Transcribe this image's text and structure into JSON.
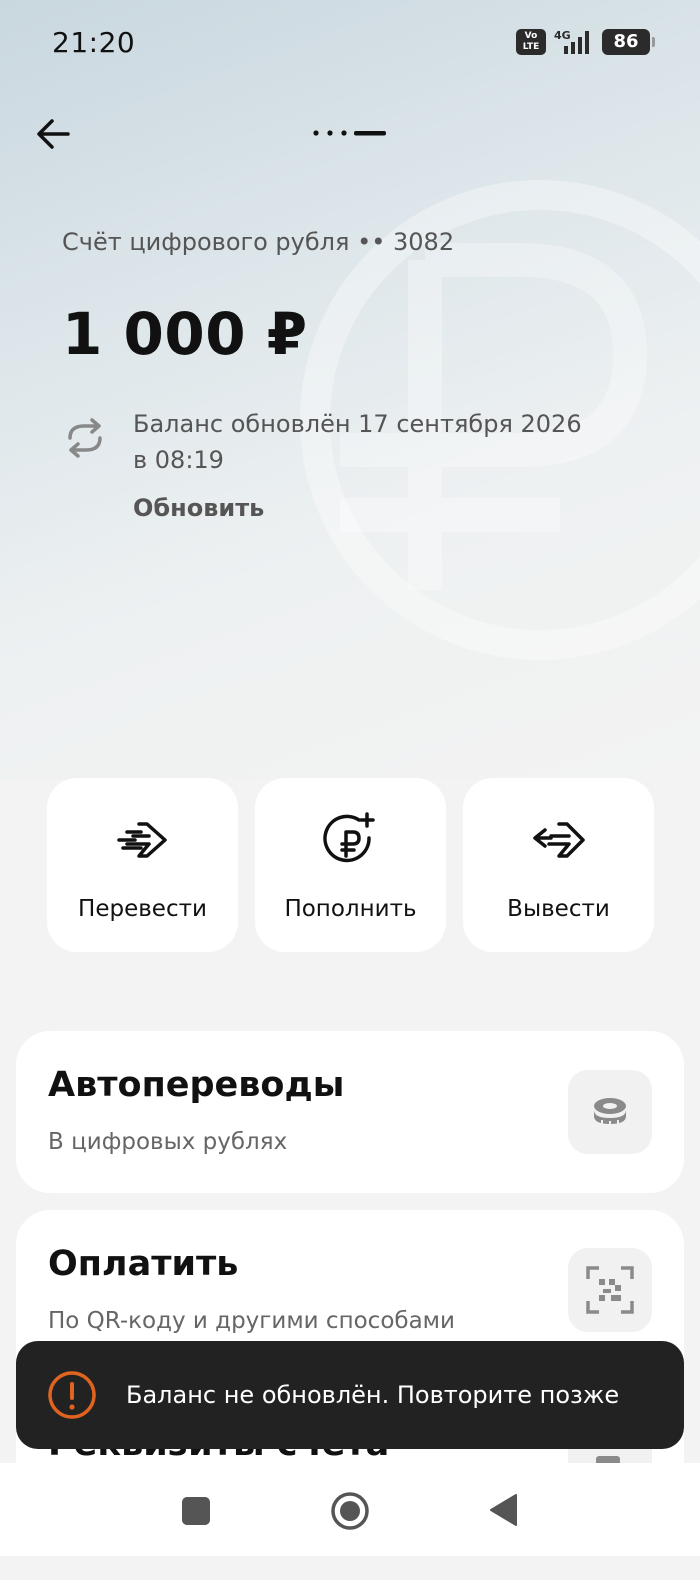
{
  "status_bar": {
    "time": "21:20",
    "volte_top": "Vo",
    "volte_bottom": "LTE",
    "network": "4G",
    "battery": "86"
  },
  "header": {
    "back_icon": "arrow-left-icon",
    "more_icon": "more-icon"
  },
  "account": {
    "title": "Счёт цифрового рубля •• 3082",
    "balance": "1 000 ₽",
    "updated_line1": "Баланс обновлён 17 сентября 2026",
    "updated_line2": "в 08:19",
    "refresh_label": "Обновить"
  },
  "actions": [
    {
      "label": "Перевести",
      "icon": "transfer-arrow-icon"
    },
    {
      "label": "Пополнить",
      "icon": "ruble-plus-icon"
    },
    {
      "label": "Вывести",
      "icon": "withdraw-arrows-icon"
    }
  ],
  "cards": [
    {
      "title": "Автопереводы",
      "subtitle": "В цифровых рублях",
      "icon": "coins-icon"
    },
    {
      "title": "Оплатить",
      "subtitle": "По QR-коду и другими способами",
      "icon": "qr-scan-icon"
    },
    {
      "title": "Реквизиты счета",
      "icon": "document-icon"
    }
  ],
  "toast": {
    "text": "Баланс не обновлён. Повторите позже",
    "icon": "warning-icon",
    "accent": "#e0631f"
  },
  "navbar": {
    "square_icon": "recent-apps-icon",
    "home_icon": "home-icon",
    "back_icon": "back-triangle-icon"
  }
}
